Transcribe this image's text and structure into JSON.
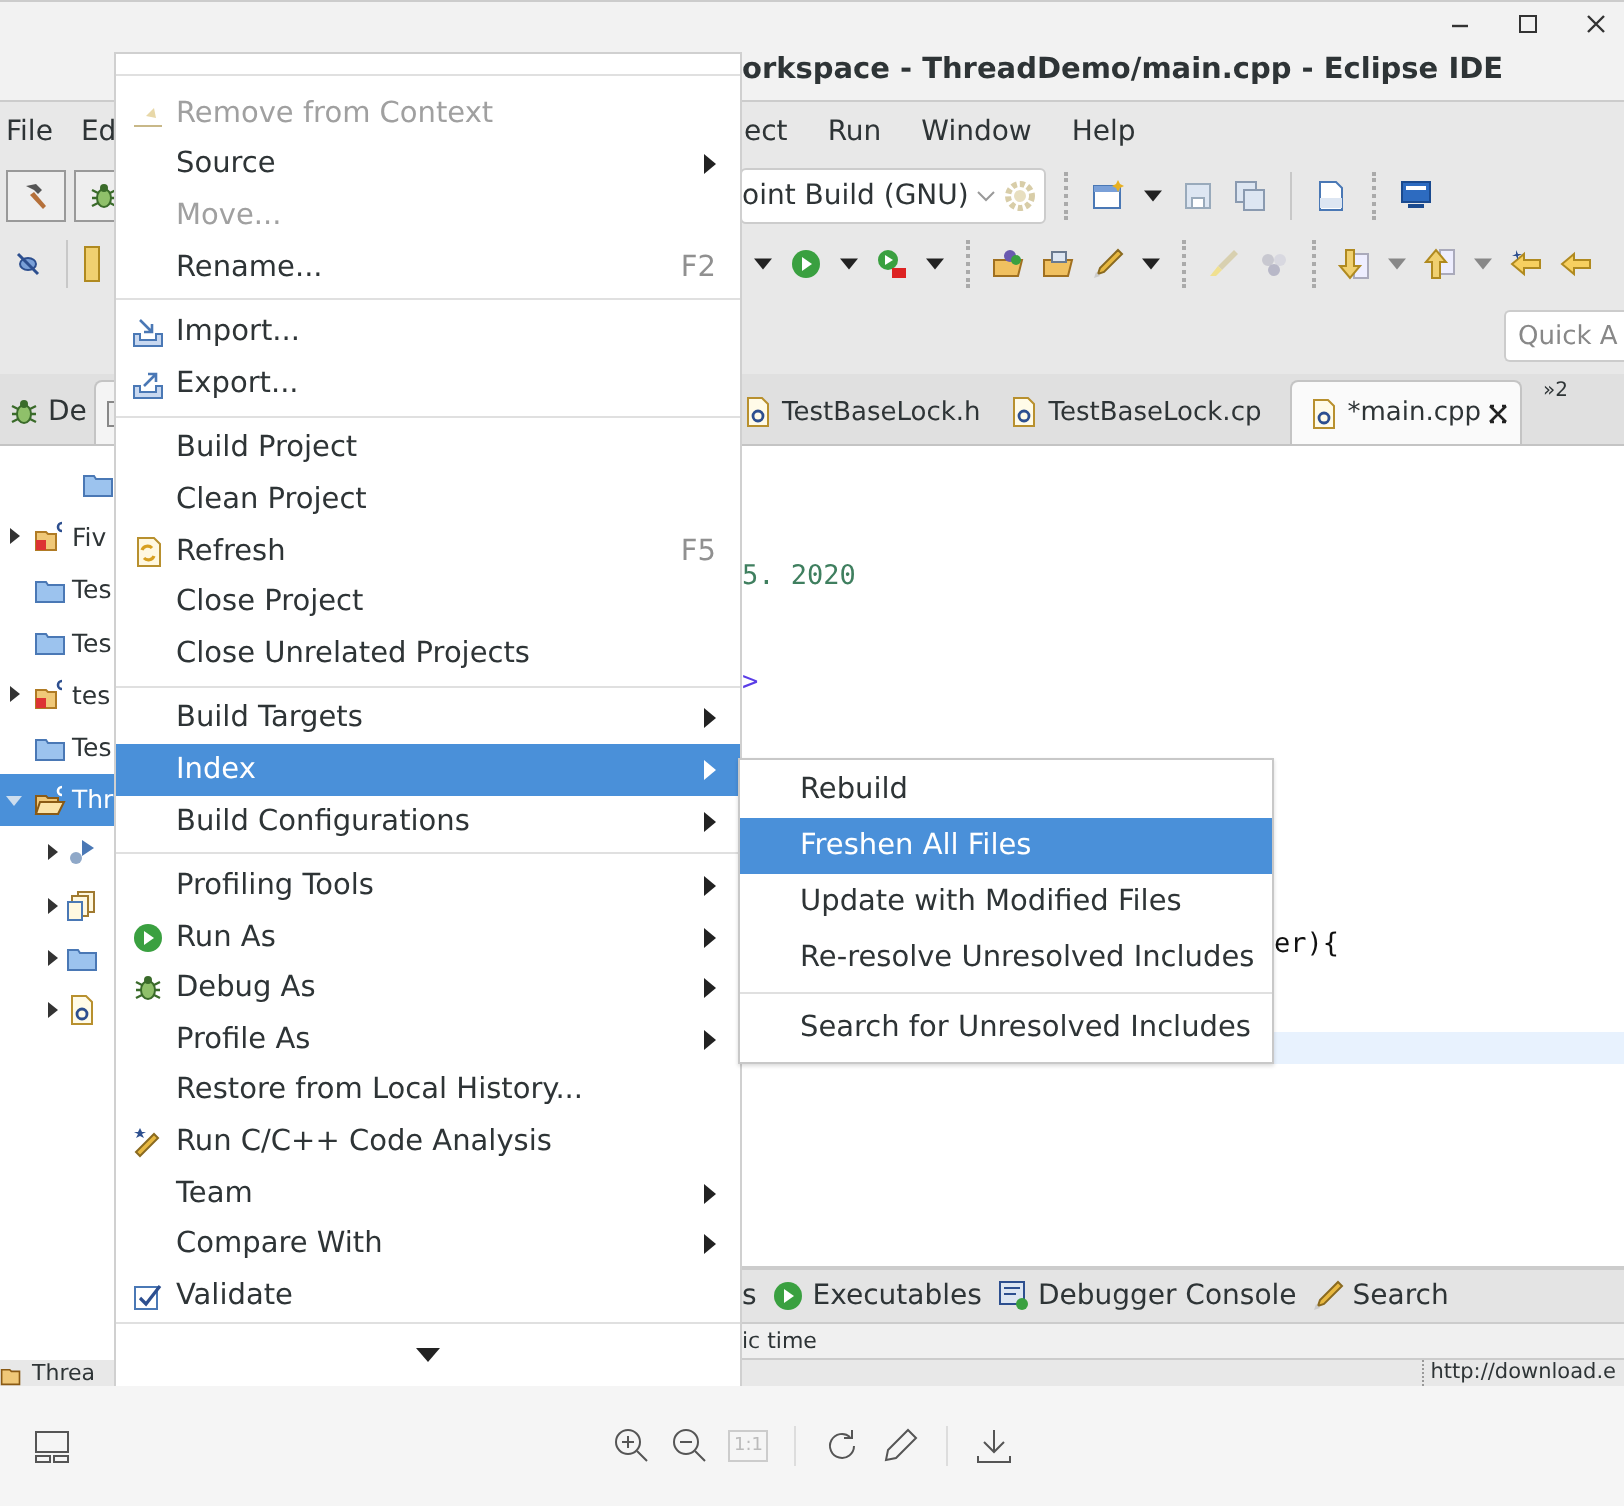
{
  "window": {
    "title": "orkspace - ThreadDemo/main.cpp - Eclipse IDE"
  },
  "menubar": {
    "left": [
      "File",
      "Ed"
    ],
    "right": [
      "ect",
      "Run",
      "Window",
      "Help"
    ]
  },
  "toolbar": {
    "build_config": "oint Build (GNU)",
    "quick_access": {
      "placeholder": "Quick A"
    }
  },
  "left_tabs": [
    {
      "label": "De",
      "selected": false
    },
    {
      "selected": true
    }
  ],
  "project_tree": [
    {
      "kind": "folder-cut"
    },
    {
      "label": "Fiv",
      "kind": "project",
      "expanded": false
    },
    {
      "label": "Tes",
      "kind": "folder"
    },
    {
      "label": "Tes",
      "kind": "folder"
    },
    {
      "label": "tes",
      "kind": "project",
      "expanded": false
    },
    {
      "label": "Tes",
      "kind": "folder"
    },
    {
      "label": "Thr",
      "kind": "open-project",
      "expanded": true,
      "selected": true,
      "children": [
        {
          "kind": "binaries",
          "expanded": false
        },
        {
          "kind": "includes",
          "expanded": false
        },
        {
          "kind": "folder",
          "expanded": false
        },
        {
          "kind": "source",
          "expanded": false
        }
      ]
    }
  ],
  "editor_tabs": [
    {
      "label": "TestBaseLock.h",
      "kind": "file",
      "selected": false
    },
    {
      "label": "TestBaseLock.cp",
      "kind": "file",
      "selected": false
    },
    {
      "label": "*main.cpp",
      "kind": "file",
      "selected": true
    },
    {
      "label": "»2",
      "kind": "overflow"
    }
  ],
  "editor_lines": [
    {
      "kind": "blank",
      "current": false
    },
    {
      "kind": "blank",
      "current": false
    },
    {
      "kind": "comment",
      "text": "5. 2020",
      "current": false
    },
    {
      "kind": "blank",
      "current": false
    },
    {
      "kind": "tag",
      "text": ">",
      "current": false
    },
    {
      "kind": "blank",
      "current": false
    },
    {
      "kind": "blank",
      "current": false
    },
    {
      "kind": "blank",
      "current": false
    },
    {
      "kind": "blank",
      "current": false
    },
    {
      "kind": "tail",
      "text": "er){",
      "current": false
    },
    {
      "kind": "blank",
      "current": false
    },
    {
      "kind": "blank",
      "current": true
    }
  ],
  "bottom_tabs": [
    {
      "label": "s"
    },
    {
      "label": "Executables"
    },
    {
      "label": "Debugger Console"
    },
    {
      "label": "Search"
    }
  ],
  "bottom_text": "ic time",
  "status_bar": {
    "left": "Threa",
    "right": "http://download.e"
  },
  "context_menu": [
    {
      "kind": "item",
      "label": "Remove from Context",
      "disabled": true,
      "submenu": false,
      "selected": false
    },
    {
      "kind": "item",
      "label": "Source",
      "disabled": false,
      "submenu": true,
      "selected": false
    },
    {
      "kind": "item",
      "label": "Move...",
      "disabled": true,
      "submenu": false,
      "selected": false
    },
    {
      "kind": "item",
      "label": "Rename...",
      "shortcut": "F2",
      "disabled": false,
      "submenu": false,
      "selected": false
    },
    {
      "kind": "separator"
    },
    {
      "kind": "item",
      "label": "Import...",
      "disabled": false,
      "submenu": false,
      "selected": false
    },
    {
      "kind": "item",
      "label": "Export...",
      "disabled": false,
      "submenu": false,
      "selected": false
    },
    {
      "kind": "separator"
    },
    {
      "kind": "item",
      "label": "Build Project",
      "disabled": false,
      "submenu": false,
      "selected": false
    },
    {
      "kind": "item",
      "label": "Clean Project",
      "disabled": false,
      "submenu": false,
      "selected": false
    },
    {
      "kind": "item",
      "label": "Refresh",
      "shortcut": "F5",
      "disabled": false,
      "submenu": false,
      "selected": false
    },
    {
      "kind": "item",
      "label": "Close Project",
      "disabled": false,
      "submenu": false,
      "selected": false
    },
    {
      "kind": "item",
      "label": "Close Unrelated Projects",
      "disabled": false,
      "submenu": false,
      "selected": false
    },
    {
      "kind": "separator"
    },
    {
      "kind": "item",
      "label": "Build Targets",
      "disabled": false,
      "submenu": true,
      "selected": false
    },
    {
      "kind": "item",
      "label": "Index",
      "disabled": false,
      "submenu": true,
      "selected": true
    },
    {
      "kind": "item",
      "label": "Build Configurations",
      "disabled": false,
      "submenu": true,
      "selected": false
    },
    {
      "kind": "separator"
    },
    {
      "kind": "item",
      "label": "Profiling Tools",
      "disabled": false,
      "submenu": true,
      "selected": false
    },
    {
      "kind": "item",
      "label": "Run As",
      "disabled": false,
      "submenu": true,
      "selected": false
    },
    {
      "kind": "item",
      "label": "Debug As",
      "disabled": false,
      "submenu": true,
      "selected": false
    },
    {
      "kind": "item",
      "label": "Profile As",
      "disabled": false,
      "submenu": true,
      "selected": false
    },
    {
      "kind": "item",
      "label": "Restore from Local History...",
      "disabled": false,
      "submenu": false,
      "selected": false
    },
    {
      "kind": "item",
      "label": "Run C/C++ Code Analysis",
      "disabled": false,
      "submenu": false,
      "selected": false
    },
    {
      "kind": "item",
      "label": "Team",
      "disabled": false,
      "submenu": true,
      "selected": false
    },
    {
      "kind": "item",
      "label": "Compare With",
      "disabled": false,
      "submenu": true,
      "selected": false
    },
    {
      "kind": "item",
      "label": "Validate",
      "disabled": false,
      "submenu": false,
      "selected": false
    }
  ],
  "index_submenu": [
    {
      "kind": "item",
      "label": "Rebuild",
      "selected": false
    },
    {
      "kind": "item",
      "label": "Freshen All Files",
      "selected": true
    },
    {
      "kind": "item",
      "label": "Update with Modified Files",
      "selected": false
    },
    {
      "kind": "item",
      "label": "Re-resolve Unresolved Includes",
      "selected": false
    },
    {
      "kind": "separator"
    },
    {
      "kind": "item",
      "label": "Search for Unresolved Includes",
      "selected": false
    }
  ],
  "viewer_toolbar": {
    "actual_size": "1:1"
  }
}
